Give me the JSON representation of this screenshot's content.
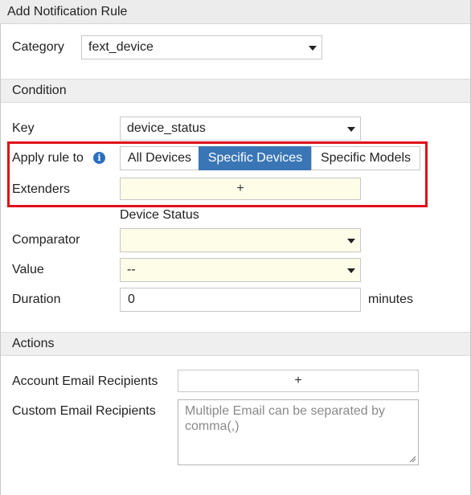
{
  "dialog": {
    "title": "Add Notification Rule"
  },
  "category": {
    "label": "Category",
    "value": "fext_device"
  },
  "condition": {
    "section_title": "Condition",
    "key": {
      "label": "Key",
      "value": "device_status"
    },
    "apply_rule": {
      "label": "Apply rule to",
      "info_icon": "info-icon",
      "options": [
        "All Devices",
        "Specific Devices",
        "Specific Models"
      ],
      "selected": "Specific Devices"
    },
    "extenders": {
      "label": "Extenders",
      "add_symbol": "+"
    },
    "device_status_heading": "Device Status",
    "comparator": {
      "label": "Comparator",
      "value": ""
    },
    "value": {
      "label": "Value",
      "value": "--"
    },
    "duration": {
      "label": "Duration",
      "value": "0",
      "unit": "minutes"
    }
  },
  "actions": {
    "section_title": "Actions",
    "account_email": {
      "label": "Account Email Recipients",
      "add_symbol": "+"
    },
    "custom_email": {
      "label": "Custom Email Recipients",
      "placeholder": "Multiple Email can be separated by comma(,)"
    }
  },
  "colors": {
    "accent": "#3a76b6",
    "highlight": "#e0101a",
    "field_yellow": "#fefde8",
    "info": "#2a6fc1"
  }
}
